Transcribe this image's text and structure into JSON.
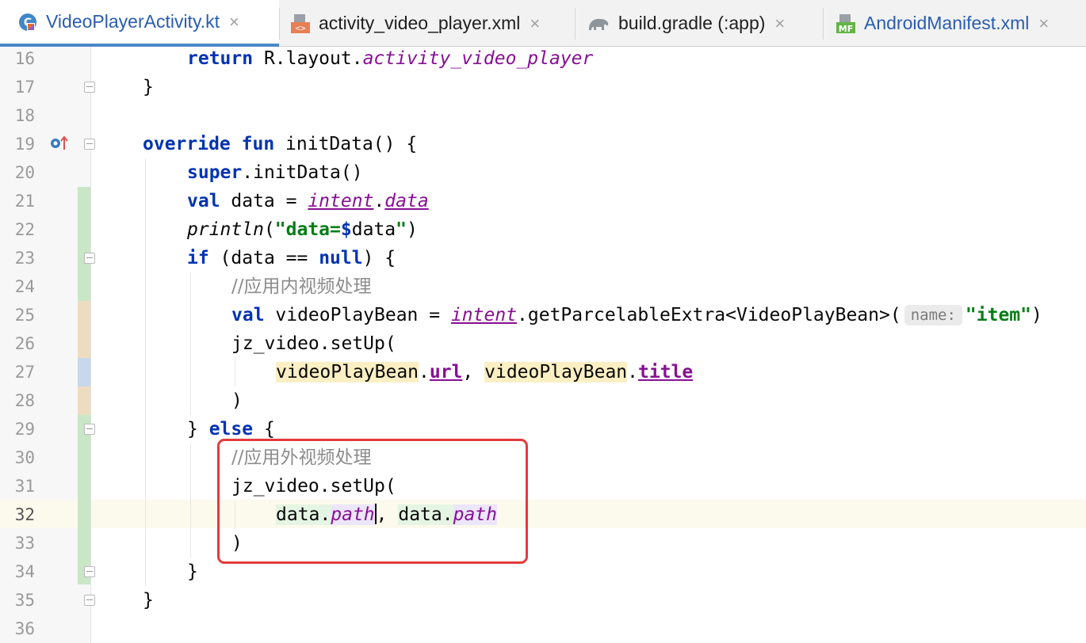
{
  "tabs": [
    {
      "label": "VideoPlayerActivity.kt",
      "icon": "kotlin-file-icon",
      "active": true
    },
    {
      "label": "activity_video_player.xml",
      "icon": "xml-layout-icon",
      "active": false
    },
    {
      "label": "build.gradle (:app)",
      "icon": "gradle-elephant-icon",
      "active": false
    },
    {
      "label": "AndroidManifest.xml",
      "icon": "manifest-file-icon",
      "active": false
    }
  ],
  "close_glyph": "×",
  "line_numbers": [
    "16",
    "17",
    "18",
    "19",
    "20",
    "21",
    "22",
    "23",
    "24",
    "25",
    "26",
    "27",
    "28",
    "29",
    "30",
    "31",
    "32",
    "33",
    "34",
    "35",
    "36"
  ],
  "current_line": "32",
  "code": {
    "l16": {
      "kw": "return",
      "pre": " R.layout.",
      "ref": "activity_video_player"
    },
    "l17": {
      "text": "}"
    },
    "l19": {
      "kw1": "override",
      "kw2": "fun",
      "rest": " initData() {"
    },
    "l20": {
      "kw": "super",
      "rest": ".initData()"
    },
    "l21": {
      "kw": "val",
      "mid": " data = ",
      "a": "intent",
      "dot": ".",
      "b": "data"
    },
    "l22": {
      "fn": "println",
      "open": "(",
      "str1": "\"data=",
      "tmpl": "$",
      "var": "data",
      "str2": "\"",
      "close": ")"
    },
    "l23": {
      "kw1": "if",
      "mid": " (data == ",
      "kw2": "null",
      "rest": ") {"
    },
    "l24": {
      "comment": "//应用内视频处理"
    },
    "l25": {
      "kw": "val",
      "mid": " videoPlayBean = ",
      "ref": "intent",
      "rest": ".getParcelableExtra<VideoPlayBean>(",
      "hint": "name:",
      "str": "\"item\"",
      "close": ")"
    },
    "l26": {
      "text": "jz_video.setUp("
    },
    "l27": {
      "v1": "videoPlayBean",
      "p1": "url",
      "sep": ", ",
      "v2": "videoPlayBean",
      "p2": "title"
    },
    "l28": {
      "text": ")"
    },
    "l29": {
      "pre": "} ",
      "kw": "else",
      "rest": " {"
    },
    "l30": {
      "comment": "//应用外视频处理"
    },
    "l31": {
      "text": "jz_video.setUp("
    },
    "l32": {
      "v1": "data",
      "p1": "path",
      "sep": ", ",
      "v2": "data",
      "p2": "path"
    },
    "l33": {
      "text": ")"
    },
    "l34": {
      "text": "}"
    },
    "l35": {
      "text": "}"
    }
  },
  "colors": {
    "accent_tab": "#4a88c7",
    "highlight_box": "#e23b3b",
    "vcs_added": "#c9e7c6",
    "vcs_modified": "#eedcc0",
    "vcs_changed_blue": "#c7d7ee"
  }
}
